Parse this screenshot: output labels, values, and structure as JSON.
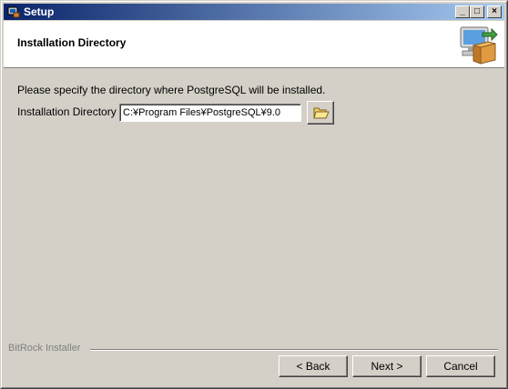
{
  "window": {
    "title": "Setup",
    "minimize": "_",
    "maximize": "□",
    "close": "×"
  },
  "header": {
    "title": "Installation Directory",
    "icon": "installer-computer-box-icon"
  },
  "main": {
    "instruction": "Please specify the directory where PostgreSQL will be installed.",
    "dir_label": "Installation Directory",
    "dir_value": "C:¥Program Files¥PostgreSQL¥9.0",
    "browse_icon": "folder-open-icon"
  },
  "footer": {
    "brand": "BitRock Installer",
    "back_label": "< Back",
    "next_label": "Next >",
    "cancel_label": "Cancel"
  }
}
